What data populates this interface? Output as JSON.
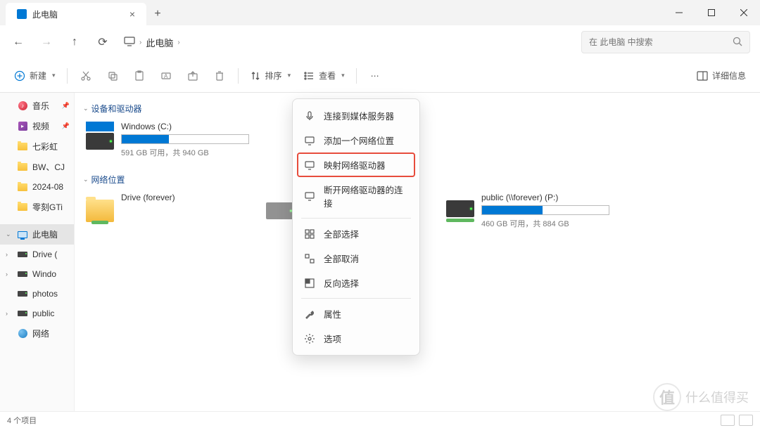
{
  "titlebar": {
    "tab_title": "此电脑",
    "new_tab": "+"
  },
  "nav": {
    "breadcrumb": "此电脑",
    "search_placeholder": "在 此电脑 中搜索"
  },
  "toolbar": {
    "new": "新建",
    "sort": "排序",
    "view": "查看",
    "details": "详细信息"
  },
  "sidebar": {
    "items": [
      {
        "label": "音乐",
        "type": "music",
        "pinned": true
      },
      {
        "label": "视频",
        "type": "video",
        "pinned": true
      },
      {
        "label": "七彩虹",
        "type": "folder"
      },
      {
        "label": "BW、CJ",
        "type": "folder"
      },
      {
        "label": "2024-08",
        "type": "folder"
      },
      {
        "label": "零刻GTi",
        "type": "folder"
      }
    ],
    "this_pc": "此电脑",
    "drives": [
      {
        "label": "Drive ("
      },
      {
        "label": "Windo"
      },
      {
        "label": "photos"
      },
      {
        "label": "public"
      }
    ],
    "network": "网络"
  },
  "content": {
    "group1": "设备和驱动器",
    "group2": "网络位置",
    "drives": [
      {
        "name": "Windows (C:)",
        "sub": "591 GB 可用，共 940 GB",
        "fill": 37
      }
    ],
    "netdrives": [
      {
        "name": "Drive (forever)",
        "sub": "",
        "fill": 0
      },
      {
        "name": "public (\\\\forever) (P:)",
        "sub": "460 GB 可用，共 884 GB",
        "fill": 48
      }
    ]
  },
  "context_menu": {
    "items": [
      {
        "label": "连接到媒体服务器",
        "icon": "media"
      },
      {
        "label": "添加一个网络位置",
        "icon": "net-add"
      },
      {
        "label": "映射网络驱动器",
        "icon": "net-map",
        "highlighted": true
      },
      {
        "label": "断开网络驱动器的连接",
        "icon": "net-disconnect"
      }
    ],
    "items2": [
      {
        "label": "全部选择",
        "icon": "select-all"
      },
      {
        "label": "全部取消",
        "icon": "deselect"
      },
      {
        "label": "反向选择",
        "icon": "invert"
      }
    ],
    "items3": [
      {
        "label": "属性",
        "icon": "properties"
      },
      {
        "label": "选项",
        "icon": "options"
      }
    ]
  },
  "statusbar": {
    "count": "4 个项目"
  },
  "watermark": "什么值得买"
}
